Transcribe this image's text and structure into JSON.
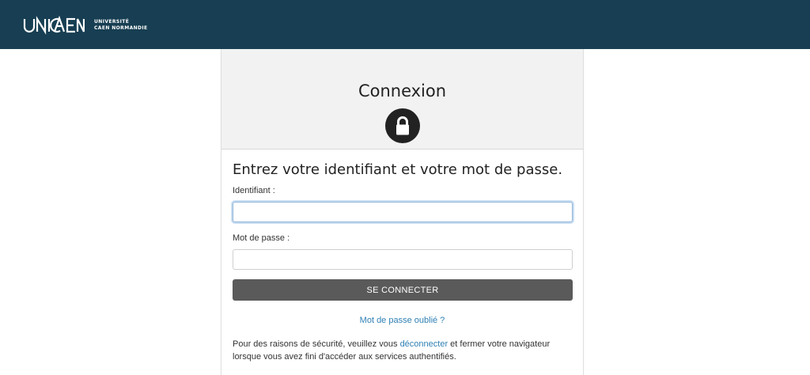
{
  "header": {
    "logo_text": "UNICAEN",
    "logo_line1": "UNIVERSITÉ",
    "logo_line2": "CAEN NORMANDIE",
    "background_color": "#173e52"
  },
  "login": {
    "title": "Connexion",
    "lock_icon": "lock-icon",
    "instructions": "Entrez votre identifiant et votre mot de passe.",
    "username_label": "Identifiant :",
    "username_value": "",
    "password_label": "Mot de passe :",
    "password_value": "",
    "submit_label": "SE CONNECTER",
    "forgot_link": "Mot de passe oublié ?",
    "notice_before": "Pour des raisons de sécurité, veuillez vous ",
    "notice_link": "déconnecter",
    "notice_after": " et fermer votre navigateur lorsque vous avez fini d'accéder aux services authentifiés.",
    "link_color": "#2f80b5",
    "button_color": "#5a5a5a"
  }
}
